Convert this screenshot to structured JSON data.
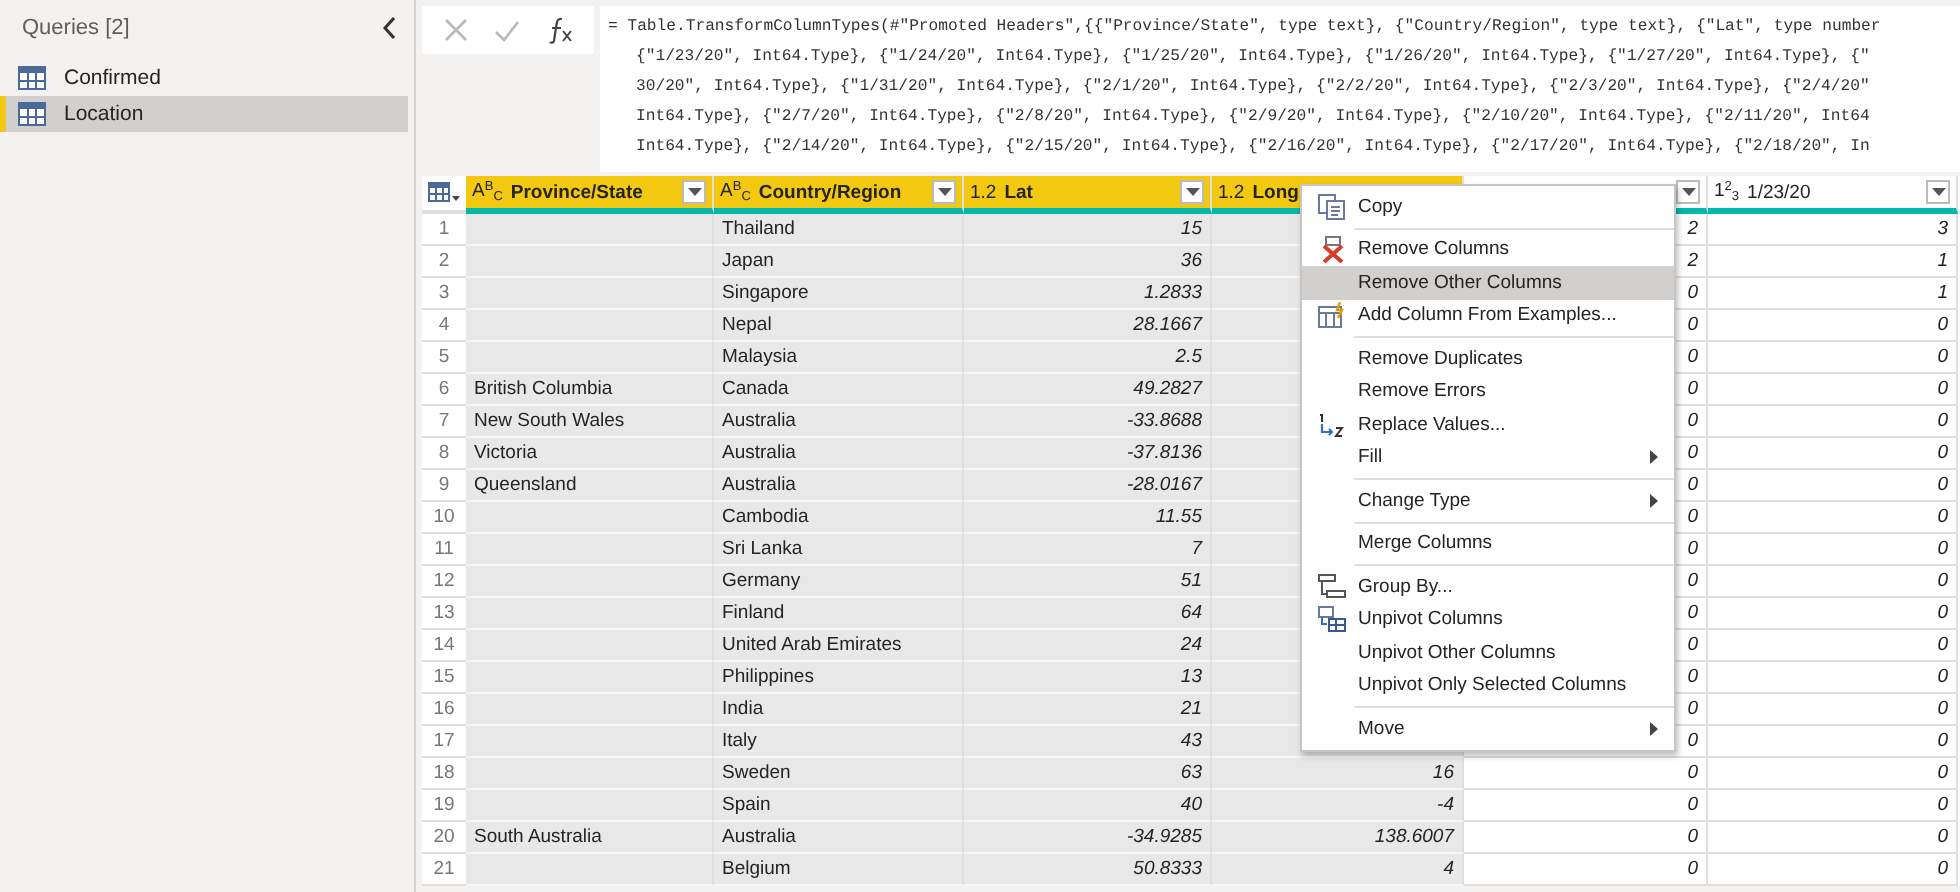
{
  "sidebar": {
    "title": "Queries [2]",
    "items": [
      {
        "label": "Confirmed",
        "selected": false
      },
      {
        "label": "Location",
        "selected": true
      }
    ]
  },
  "formula_bar": {
    "lines": [
      "= Table.TransformColumnTypes(#\"Promoted Headers\",{{\"Province/State\", type text}, {\"Country/Region\", type text}, {\"Lat\", type number",
      "{\"1/23/20\", Int64.Type}, {\"1/24/20\", Int64.Type}, {\"1/25/20\", Int64.Type}, {\"1/26/20\", Int64.Type}, {\"1/27/20\", Int64.Type}, {\"",
      "30/20\", Int64.Type}, {\"1/31/20\", Int64.Type}, {\"2/1/20\", Int64.Type}, {\"2/2/20\", Int64.Type}, {\"2/3/20\", Int64.Type}, {\"2/4/20\"",
      "Int64.Type}, {\"2/7/20\", Int64.Type}, {\"2/8/20\", Int64.Type}, {\"2/9/20\", Int64.Type}, {\"2/10/20\", Int64.Type}, {\"2/11/20\", Int64",
      "Int64.Type}, {\"2/14/20\", Int64.Type}, {\"2/15/20\", Int64.Type}, {\"2/16/20\", Int64.Type}, {\"2/17/20\", Int64.Type}, {\"2/18/20\", In"
    ]
  },
  "table": {
    "columns": [
      {
        "type_label": "A$^{B}$$_{C}$",
        "name": "Province/State",
        "selected": true,
        "dropdown": true,
        "kind": "text"
      },
      {
        "type_label": "A$^{B}$$_{C}$",
        "name": "Country/Region",
        "selected": true,
        "dropdown": true,
        "kind": "text"
      },
      {
        "type_label": "1.2",
        "name": "Lat",
        "selected": true,
        "dropdown": true,
        "kind": "number"
      },
      {
        "type_label": "1.2",
        "name": "Long",
        "selected": true,
        "dropdown": false,
        "kind": "number"
      },
      {
        "selected": false,
        "dropdown": true,
        "kind": "number"
      },
      {
        "type_label": "1$^{2}$$_{3}$",
        "name": "1/23/20",
        "selected": false,
        "dropdown": true,
        "kind": "number"
      }
    ],
    "rows": [
      {
        "n": "1",
        "cells": [
          null,
          "Thailand",
          "15",
          null,
          "2",
          "3"
        ]
      },
      {
        "n": "2",
        "cells": [
          null,
          "Japan",
          "36",
          null,
          "2",
          "1"
        ]
      },
      {
        "n": "3",
        "cells": [
          null,
          "Singapore",
          "1.2833",
          null,
          "0",
          "1"
        ]
      },
      {
        "n": "4",
        "cells": [
          null,
          "Nepal",
          "28.1667",
          null,
          "0",
          "0"
        ]
      },
      {
        "n": "5",
        "cells": [
          null,
          "Malaysia",
          "2.5",
          null,
          "0",
          "0"
        ]
      },
      {
        "n": "6",
        "cells": [
          "British Columbia",
          "Canada",
          "49.2827",
          null,
          "0",
          "0"
        ]
      },
      {
        "n": "7",
        "cells": [
          "New South Wales",
          "Australia",
          "-33.8688",
          null,
          "0",
          "0"
        ]
      },
      {
        "n": "8",
        "cells": [
          "Victoria",
          "Australia",
          "-37.8136",
          null,
          "0",
          "0"
        ]
      },
      {
        "n": "9",
        "cells": [
          "Queensland",
          "Australia",
          "-28.0167",
          null,
          "0",
          "0"
        ]
      },
      {
        "n": "10",
        "cells": [
          null,
          "Cambodia",
          "11.55",
          null,
          "0",
          "0"
        ]
      },
      {
        "n": "11",
        "cells": [
          null,
          "Sri Lanka",
          "7",
          null,
          "0",
          "0"
        ]
      },
      {
        "n": "12",
        "cells": [
          null,
          "Germany",
          "51",
          null,
          "0",
          "0"
        ]
      },
      {
        "n": "13",
        "cells": [
          null,
          "Finland",
          "64",
          null,
          "0",
          "0"
        ]
      },
      {
        "n": "14",
        "cells": [
          null,
          "United Arab Emirates",
          "24",
          null,
          "0",
          "0"
        ]
      },
      {
        "n": "15",
        "cells": [
          null,
          "Philippines",
          "13",
          null,
          "0",
          "0"
        ]
      },
      {
        "n": "16",
        "cells": [
          null,
          "India",
          "21",
          null,
          "0",
          "0"
        ]
      },
      {
        "n": "17",
        "cells": [
          null,
          "Italy",
          "43",
          null,
          "0",
          "0"
        ]
      },
      {
        "n": "18",
        "cells": [
          null,
          "Sweden",
          "63",
          "16",
          "0",
          "0"
        ]
      },
      {
        "n": "19",
        "cells": [
          null,
          "Spain",
          "40",
          "-4",
          "0",
          "0"
        ]
      },
      {
        "n": "20",
        "cells": [
          "South Australia",
          "Australia",
          "-34.9285",
          "138.6007",
          "0",
          "0"
        ]
      },
      {
        "n": "21",
        "cells": [
          null,
          "Belgium",
          "50.8333",
          "4",
          "0",
          "0"
        ]
      }
    ]
  },
  "context_menu": {
    "items": [
      {
        "label": "Copy",
        "kind": "copy",
        "separator_before": false,
        "submenu": false,
        "selected": false
      },
      {
        "label": "Remove Columns",
        "kind": "remove",
        "separator_before": true,
        "submenu": false,
        "selected": false
      },
      {
        "label": "Remove Other Columns",
        "kind": "plain",
        "separator_before": false,
        "submenu": false,
        "selected": true
      },
      {
        "label": "Add Column From Examples...",
        "kind": "examples",
        "separator_before": false,
        "submenu": false,
        "selected": false
      },
      {
        "label": "Remove Duplicates",
        "kind": "plain",
        "separator_before": true,
        "submenu": false,
        "selected": false
      },
      {
        "label": "Remove Errors",
        "kind": "plain",
        "separator_before": false,
        "submenu": false,
        "selected": false
      },
      {
        "label": "Replace Values...",
        "kind": "replace",
        "separator_before": false,
        "submenu": false,
        "selected": false
      },
      {
        "label": "Fill",
        "kind": "plain",
        "separator_before": false,
        "submenu": true,
        "selected": false
      },
      {
        "label": "Change Type",
        "kind": "plain",
        "separator_before": true,
        "submenu": true,
        "selected": false
      },
      {
        "label": "Merge Columns",
        "kind": "plain",
        "separator_before": true,
        "submenu": false,
        "selected": false
      },
      {
        "label": "Group By...",
        "kind": "group",
        "separator_before": true,
        "submenu": false,
        "selected": false
      },
      {
        "label": "Unpivot Columns",
        "kind": "unpivot",
        "separator_before": false,
        "submenu": false,
        "selected": false
      },
      {
        "label": "Unpivot Other Columns",
        "kind": "plain",
        "separator_before": false,
        "submenu": false,
        "selected": false
      },
      {
        "label": "Unpivot Only Selected Columns",
        "kind": "plain",
        "separator_before": false,
        "submenu": false,
        "selected": false
      },
      {
        "label": "Move",
        "kind": "plain",
        "separator_before": true,
        "submenu": true,
        "selected": false
      }
    ]
  }
}
